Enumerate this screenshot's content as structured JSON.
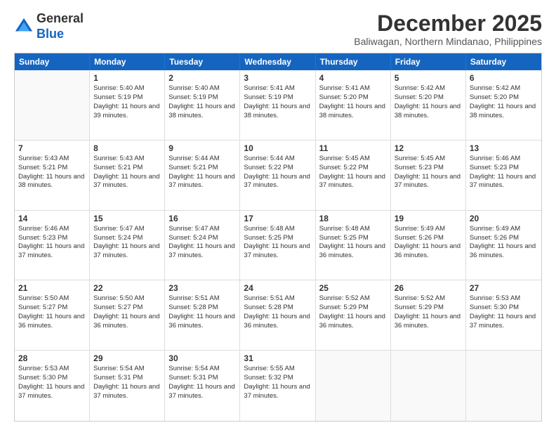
{
  "logo": {
    "general": "General",
    "blue": "Blue"
  },
  "header": {
    "month": "December 2025",
    "location": "Baliwagan, Northern Mindanao, Philippines"
  },
  "weekdays": [
    "Sunday",
    "Monday",
    "Tuesday",
    "Wednesday",
    "Thursday",
    "Friday",
    "Saturday"
  ],
  "weeks": [
    [
      {
        "day": "",
        "sunrise": "",
        "sunset": "",
        "daylight": ""
      },
      {
        "day": "1",
        "sunrise": "Sunrise: 5:40 AM",
        "sunset": "Sunset: 5:19 PM",
        "daylight": "Daylight: 11 hours and 39 minutes."
      },
      {
        "day": "2",
        "sunrise": "Sunrise: 5:40 AM",
        "sunset": "Sunset: 5:19 PM",
        "daylight": "Daylight: 11 hours and 38 minutes."
      },
      {
        "day": "3",
        "sunrise": "Sunrise: 5:41 AM",
        "sunset": "Sunset: 5:19 PM",
        "daylight": "Daylight: 11 hours and 38 minutes."
      },
      {
        "day": "4",
        "sunrise": "Sunrise: 5:41 AM",
        "sunset": "Sunset: 5:20 PM",
        "daylight": "Daylight: 11 hours and 38 minutes."
      },
      {
        "day": "5",
        "sunrise": "Sunrise: 5:42 AM",
        "sunset": "Sunset: 5:20 PM",
        "daylight": "Daylight: 11 hours and 38 minutes."
      },
      {
        "day": "6",
        "sunrise": "Sunrise: 5:42 AM",
        "sunset": "Sunset: 5:20 PM",
        "daylight": "Daylight: 11 hours and 38 minutes."
      }
    ],
    [
      {
        "day": "7",
        "sunrise": "Sunrise: 5:43 AM",
        "sunset": "Sunset: 5:21 PM",
        "daylight": "Daylight: 11 hours and 38 minutes."
      },
      {
        "day": "8",
        "sunrise": "Sunrise: 5:43 AM",
        "sunset": "Sunset: 5:21 PM",
        "daylight": "Daylight: 11 hours and 37 minutes."
      },
      {
        "day": "9",
        "sunrise": "Sunrise: 5:44 AM",
        "sunset": "Sunset: 5:21 PM",
        "daylight": "Daylight: 11 hours and 37 minutes."
      },
      {
        "day": "10",
        "sunrise": "Sunrise: 5:44 AM",
        "sunset": "Sunset: 5:22 PM",
        "daylight": "Daylight: 11 hours and 37 minutes."
      },
      {
        "day": "11",
        "sunrise": "Sunrise: 5:45 AM",
        "sunset": "Sunset: 5:22 PM",
        "daylight": "Daylight: 11 hours and 37 minutes."
      },
      {
        "day": "12",
        "sunrise": "Sunrise: 5:45 AM",
        "sunset": "Sunset: 5:23 PM",
        "daylight": "Daylight: 11 hours and 37 minutes."
      },
      {
        "day": "13",
        "sunrise": "Sunrise: 5:46 AM",
        "sunset": "Sunset: 5:23 PM",
        "daylight": "Daylight: 11 hours and 37 minutes."
      }
    ],
    [
      {
        "day": "14",
        "sunrise": "Sunrise: 5:46 AM",
        "sunset": "Sunset: 5:23 PM",
        "daylight": "Daylight: 11 hours and 37 minutes."
      },
      {
        "day": "15",
        "sunrise": "Sunrise: 5:47 AM",
        "sunset": "Sunset: 5:24 PM",
        "daylight": "Daylight: 11 hours and 37 minutes."
      },
      {
        "day": "16",
        "sunrise": "Sunrise: 5:47 AM",
        "sunset": "Sunset: 5:24 PM",
        "daylight": "Daylight: 11 hours and 37 minutes."
      },
      {
        "day": "17",
        "sunrise": "Sunrise: 5:48 AM",
        "sunset": "Sunset: 5:25 PM",
        "daylight": "Daylight: 11 hours and 37 minutes."
      },
      {
        "day": "18",
        "sunrise": "Sunrise: 5:48 AM",
        "sunset": "Sunset: 5:25 PM",
        "daylight": "Daylight: 11 hours and 36 minutes."
      },
      {
        "day": "19",
        "sunrise": "Sunrise: 5:49 AM",
        "sunset": "Sunset: 5:26 PM",
        "daylight": "Daylight: 11 hours and 36 minutes."
      },
      {
        "day": "20",
        "sunrise": "Sunrise: 5:49 AM",
        "sunset": "Sunset: 5:26 PM",
        "daylight": "Daylight: 11 hours and 36 minutes."
      }
    ],
    [
      {
        "day": "21",
        "sunrise": "Sunrise: 5:50 AM",
        "sunset": "Sunset: 5:27 PM",
        "daylight": "Daylight: 11 hours and 36 minutes."
      },
      {
        "day": "22",
        "sunrise": "Sunrise: 5:50 AM",
        "sunset": "Sunset: 5:27 PM",
        "daylight": "Daylight: 11 hours and 36 minutes."
      },
      {
        "day": "23",
        "sunrise": "Sunrise: 5:51 AM",
        "sunset": "Sunset: 5:28 PM",
        "daylight": "Daylight: 11 hours and 36 minutes."
      },
      {
        "day": "24",
        "sunrise": "Sunrise: 5:51 AM",
        "sunset": "Sunset: 5:28 PM",
        "daylight": "Daylight: 11 hours and 36 minutes."
      },
      {
        "day": "25",
        "sunrise": "Sunrise: 5:52 AM",
        "sunset": "Sunset: 5:29 PM",
        "daylight": "Daylight: 11 hours and 36 minutes."
      },
      {
        "day": "26",
        "sunrise": "Sunrise: 5:52 AM",
        "sunset": "Sunset: 5:29 PM",
        "daylight": "Daylight: 11 hours and 36 minutes."
      },
      {
        "day": "27",
        "sunrise": "Sunrise: 5:53 AM",
        "sunset": "Sunset: 5:30 PM",
        "daylight": "Daylight: 11 hours and 37 minutes."
      }
    ],
    [
      {
        "day": "28",
        "sunrise": "Sunrise: 5:53 AM",
        "sunset": "Sunset: 5:30 PM",
        "daylight": "Daylight: 11 hours and 37 minutes."
      },
      {
        "day": "29",
        "sunrise": "Sunrise: 5:54 AM",
        "sunset": "Sunset: 5:31 PM",
        "daylight": "Daylight: 11 hours and 37 minutes."
      },
      {
        "day": "30",
        "sunrise": "Sunrise: 5:54 AM",
        "sunset": "Sunset: 5:31 PM",
        "daylight": "Daylight: 11 hours and 37 minutes."
      },
      {
        "day": "31",
        "sunrise": "Sunrise: 5:55 AM",
        "sunset": "Sunset: 5:32 PM",
        "daylight": "Daylight: 11 hours and 37 minutes."
      },
      {
        "day": "",
        "sunrise": "",
        "sunset": "",
        "daylight": ""
      },
      {
        "day": "",
        "sunrise": "",
        "sunset": "",
        "daylight": ""
      },
      {
        "day": "",
        "sunrise": "",
        "sunset": "",
        "daylight": ""
      }
    ]
  ]
}
